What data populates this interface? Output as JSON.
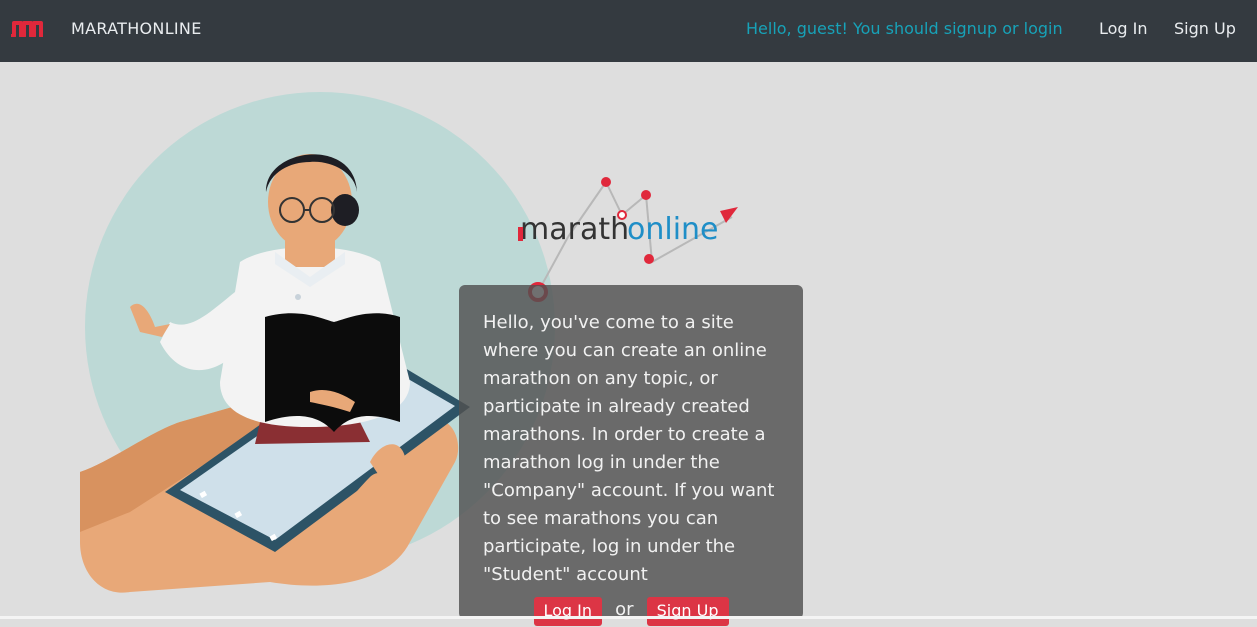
{
  "navbar": {
    "brand": "MARATHONLINE",
    "greeting": "Hello, guest! You should signup or login",
    "login_label": "Log In",
    "signup_label": "Sign Up"
  },
  "hero": {
    "logo_text_prefix": "marath",
    "logo_text_suffix": "online",
    "intro": "Hello, you've come to a site where you can create an online marathon on any topic, or participate in already created marathons. In order to create a marathon log in under the \"Company\" account. If you want to see marathons you can participate, log in under the \"Student\" account",
    "login_label": "Log In",
    "or_label": "or",
    "signup_label": "Sign Up"
  },
  "colors": {
    "navbar_bg": "#343a40",
    "accent_red": "#dc3545",
    "greeting_teal": "#17a2b8",
    "page_bg": "#dedede"
  },
  "icons": [
    "brand-m-icon",
    "teacher-phone-illustration",
    "marathonline-logo"
  ]
}
